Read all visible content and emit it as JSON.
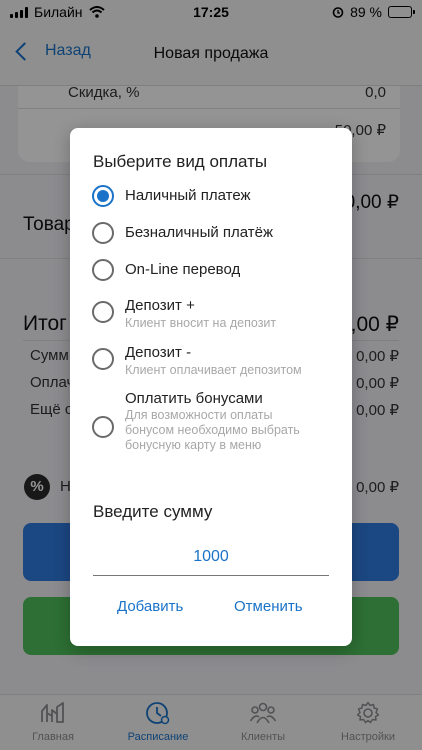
{
  "status": {
    "carrier": "Билайн",
    "time": "17:25",
    "battery": "89 %",
    "battery_level": 0.89
  },
  "nav": {
    "back_label": "Назад",
    "title": "Новая продажа"
  },
  "form": {
    "discount_label": "Скидка, %",
    "discount_value": "0,0",
    "card_total_value": "50,00 ₽",
    "goods_label": "Товар",
    "goods_value": "0,00 ₽",
    "total_label": "Итог",
    "total_value": ",00 ₽",
    "sum_label": "Сумм",
    "sum_value": "0,00 ₽",
    "paid_label": "Оплач",
    "paid_value": "0,00 ₽",
    "more_label": "Ещё с",
    "more_value": "0,00 ₽",
    "promo_icon_glyph": "%",
    "promo_label": "Н",
    "promo_value": "0,00 ₽"
  },
  "dialog": {
    "title": "Выберите вид оплаты",
    "options": [
      {
        "label": "Наличный платеж",
        "sub": "",
        "selected": true
      },
      {
        "label": "Безналичный платёж",
        "sub": "",
        "selected": false
      },
      {
        "label": "On-Line перевод",
        "sub": "",
        "selected": false
      },
      {
        "label": "Депозит +",
        "sub": "Клиент вносит на депозит",
        "selected": false
      },
      {
        "label": "Депозит -",
        "sub": "Клиент оплачивает депозитом",
        "selected": false
      },
      {
        "label": "Оплатить бонусами",
        "sub": "Для возможности оплаты бонусом необходимо выбрать бонусную карту в меню",
        "selected": false
      }
    ],
    "amount_title": "Введите сумму",
    "amount_value": "1000",
    "add_label": "Добавить",
    "cancel_label": "Отменить"
  },
  "tabbar": {
    "items": [
      {
        "label": "Главная",
        "icon": "chart-icon",
        "active": false
      },
      {
        "label": "Расписание",
        "icon": "clock-icon",
        "active": true
      },
      {
        "label": "Клиенты",
        "icon": "users-icon",
        "active": false
      },
      {
        "label": "Настройки",
        "icon": "gear-icon",
        "active": false
      }
    ]
  },
  "colors": {
    "accent": "#1a73c8",
    "primary_button": "#2f7be0",
    "success_button": "#4fbf5b"
  }
}
